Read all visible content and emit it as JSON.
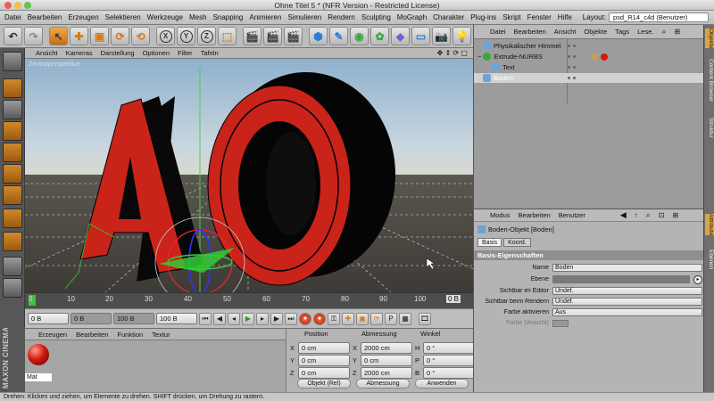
{
  "window": {
    "title": "Ohne Titel 5 * (NFR Version - Restricted License)"
  },
  "menubar": {
    "items": [
      "Datei",
      "Bearbeiten",
      "Erzeugen",
      "Selektieren",
      "Werkzeuge",
      "Mesh",
      "Snapping",
      "Animieren",
      "Simulieren",
      "Rendern",
      "Sculpting",
      "MoGraph",
      "Charakter",
      "Plug-ins",
      "Skript",
      "Fenster",
      "Hilfe"
    ],
    "layout_label": "Layout:",
    "layout_value": "psd_R14_c4d (Benutzer)"
  },
  "maintoolbar": {
    "axis_x": "X",
    "axis_y": "Y",
    "axis_z": "Z"
  },
  "viewport": {
    "menu": [
      "Ansicht",
      "Kameras",
      "Darstellung",
      "Optionen",
      "Filter",
      "Tafeln"
    ],
    "label": "Zentralperspektive"
  },
  "timeline": {
    "ticks": [
      "0",
      "10",
      "20",
      "30",
      "40",
      "50",
      "60",
      "70",
      "80",
      "90",
      "100"
    ],
    "end_marker": "0 B"
  },
  "transport": {
    "start": "0 B",
    "min": "0 B",
    "max": "100 B",
    "end": "100 B"
  },
  "material": {
    "menu": [
      "Erzeugen",
      "Bearbeiten",
      "Funktion",
      "Textur"
    ],
    "name": "Mat",
    "color": "#d41a0d"
  },
  "coordinates": {
    "headers": [
      "Position",
      "Abmessung",
      "Winkel"
    ],
    "rows": [
      {
        "axis": "X",
        "pos": "0 cm",
        "size_axis": "X",
        "size": "2000 cm",
        "ang_axis": "H",
        "ang": "0 °"
      },
      {
        "axis": "Y",
        "pos": "0 cm",
        "size_axis": "Y",
        "size": "0 cm",
        "ang_axis": "P",
        "ang": "0 °"
      },
      {
        "axis": "Z",
        "pos": "0 cm",
        "size_axis": "Z",
        "size": "2000 cm",
        "ang_axis": "B",
        "ang": "0 °"
      }
    ],
    "mode1": "Objekt (Rel)",
    "mode2": "Abmessung",
    "apply": "Anwenden"
  },
  "objects": {
    "menu": [
      "Datei",
      "Bearbeiten",
      "Ansicht",
      "Objekte",
      "Tags",
      "Lese."
    ],
    "items": [
      {
        "name": "Physikalischer Himmel",
        "indent": 0
      },
      {
        "name": "Extrude-NURBS",
        "indent": 0
      },
      {
        "name": "Text",
        "indent": 1
      },
      {
        "name": "Boden",
        "indent": 0
      }
    ]
  },
  "attributes": {
    "menu": [
      "Modus",
      "Bearbeiten",
      "Benutzer"
    ],
    "object_title": "Boden-Objekt [Boden]",
    "tabs": [
      "Basis",
      "Koord."
    ],
    "section": "Basis-Eigenschaften",
    "rows": [
      {
        "label": "Name",
        "value": "Boden"
      },
      {
        "label": "Ebene",
        "value": ""
      },
      {
        "label": "Sichtbar im Editor",
        "value": "Undef."
      },
      {
        "label": "Sichtbar beim Rendern",
        "value": "Undef."
      },
      {
        "label": "Farbe aktivieren",
        "value": "Aus"
      },
      {
        "label": "Farbe (Ansicht)",
        "value": ""
      }
    ]
  },
  "sidetabs": [
    "Objekte",
    "Content Browser",
    "Struktur",
    "Attribute",
    "Ebenen"
  ],
  "status": "Drehen: Klicken und ziehen, um Elemente zu drehen. SHIFT drücken, um Drehung zu rastern.",
  "logo": "MAXON CINEMA 4D"
}
